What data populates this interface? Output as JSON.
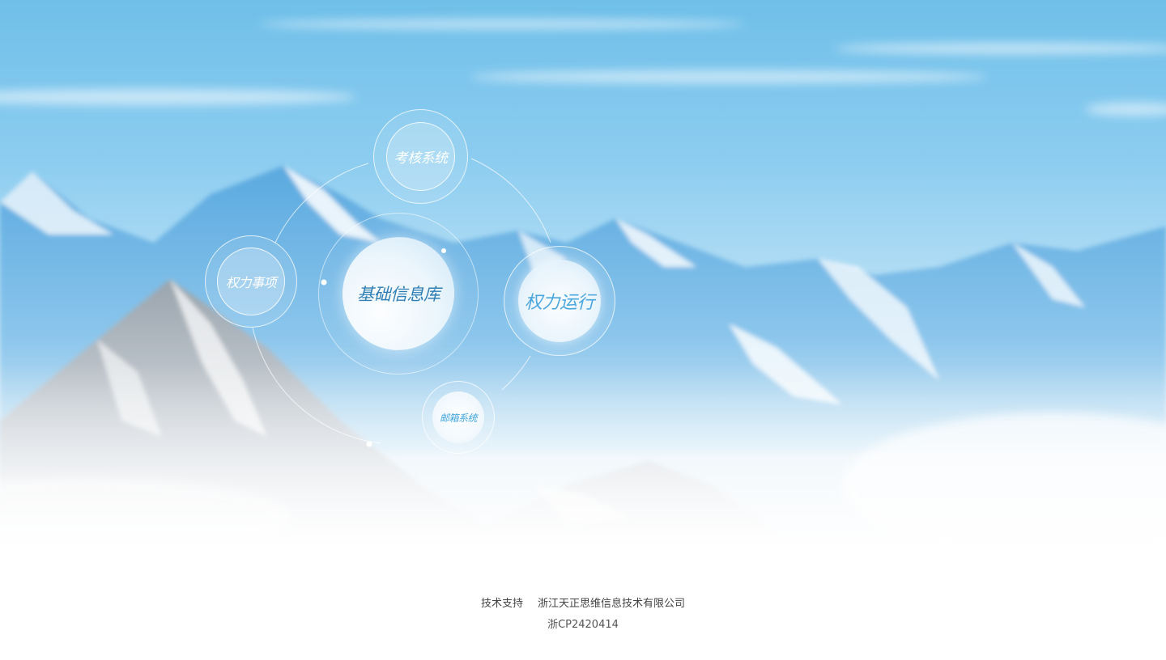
{
  "nodes": {
    "kaohe": "考核系统",
    "shixiang": "权力事项",
    "jichu": "基础信息库",
    "yunxing": "权力运行",
    "youxiang": "邮箱系统"
  },
  "footer": {
    "support_label": "技术支持",
    "company": "浙江天正思维信息技术有限公司",
    "icp": "浙CP2420414"
  },
  "colors": {
    "sky": "#6fbfe9",
    "primary_text": "#2f7fb5",
    "accent_text": "#4aa6dd",
    "footer_text": "#444444"
  }
}
